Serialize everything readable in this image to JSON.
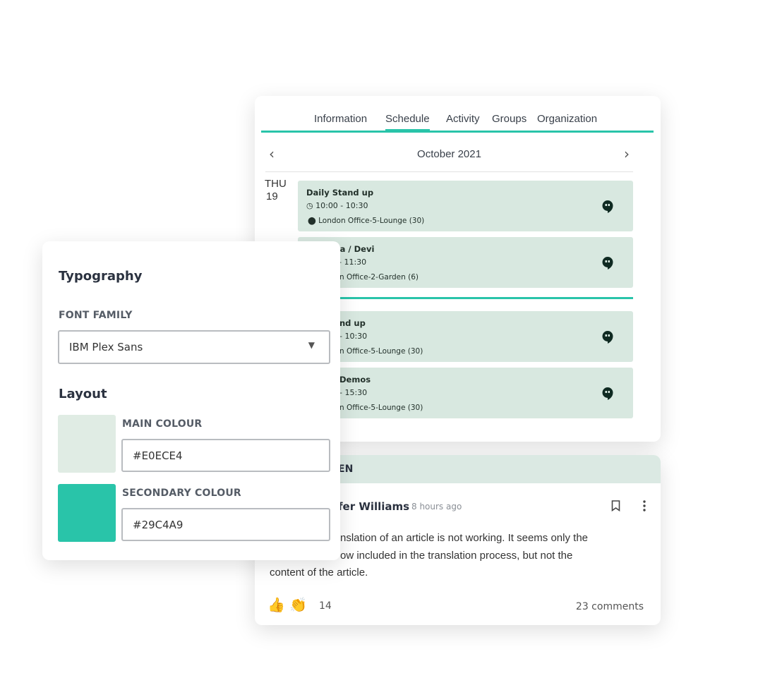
{
  "schedule": {
    "tabs": [
      {
        "label": "Information",
        "active": false
      },
      {
        "label": "Schedule",
        "active": true
      },
      {
        "label": "Activity",
        "active": false
      },
      {
        "label": "Groups",
        "active": false
      },
      {
        "label": "Organization",
        "active": false
      }
    ],
    "month": "October 2021",
    "day_name": "THU",
    "day_num": "19",
    "events": [
      {
        "title": "Daily Stand up",
        "time": "10:00 - 10:30",
        "location": "London Office-5-Lounge (30)"
      },
      {
        "title": "ra / Devi",
        "time": "- 11:30",
        "location": "n Office-2-Garden (6)"
      },
      {
        "title": "nd up",
        "time": "- 10:30",
        "location": "n Office-5-Lounge (30)"
      },
      {
        "title": "Demos",
        "time": "- 15:30",
        "location": "n Office-5-Lounge (30)"
      }
    ],
    "event_icon": "hangouts-icon",
    "accent": "#29C4A9",
    "event_bg": "#D8E8E0"
  },
  "comment": {
    "header": "EN",
    "author": "fer Williams",
    "time_ago": "8 hours ago",
    "body_lines": [
      "nslation of an article is not working. It seems only the",
      "ow included in the translation process, but not the",
      "content of the article."
    ],
    "reactions": [
      "👍",
      "👏"
    ],
    "reaction_count": "14",
    "comments": "23 comments"
  },
  "typography": {
    "title": "Typography",
    "font_family_label": "FONT FAMILY",
    "font_family_value": "IBM Plex Sans",
    "layout_title": "Layout",
    "main_colour_label": "MAIN COLOUR",
    "main_colour_value": "#E0ECE4",
    "secondary_colour_label": "SECONDARY COLOUR",
    "secondary_colour_value": "#29C4A9"
  }
}
